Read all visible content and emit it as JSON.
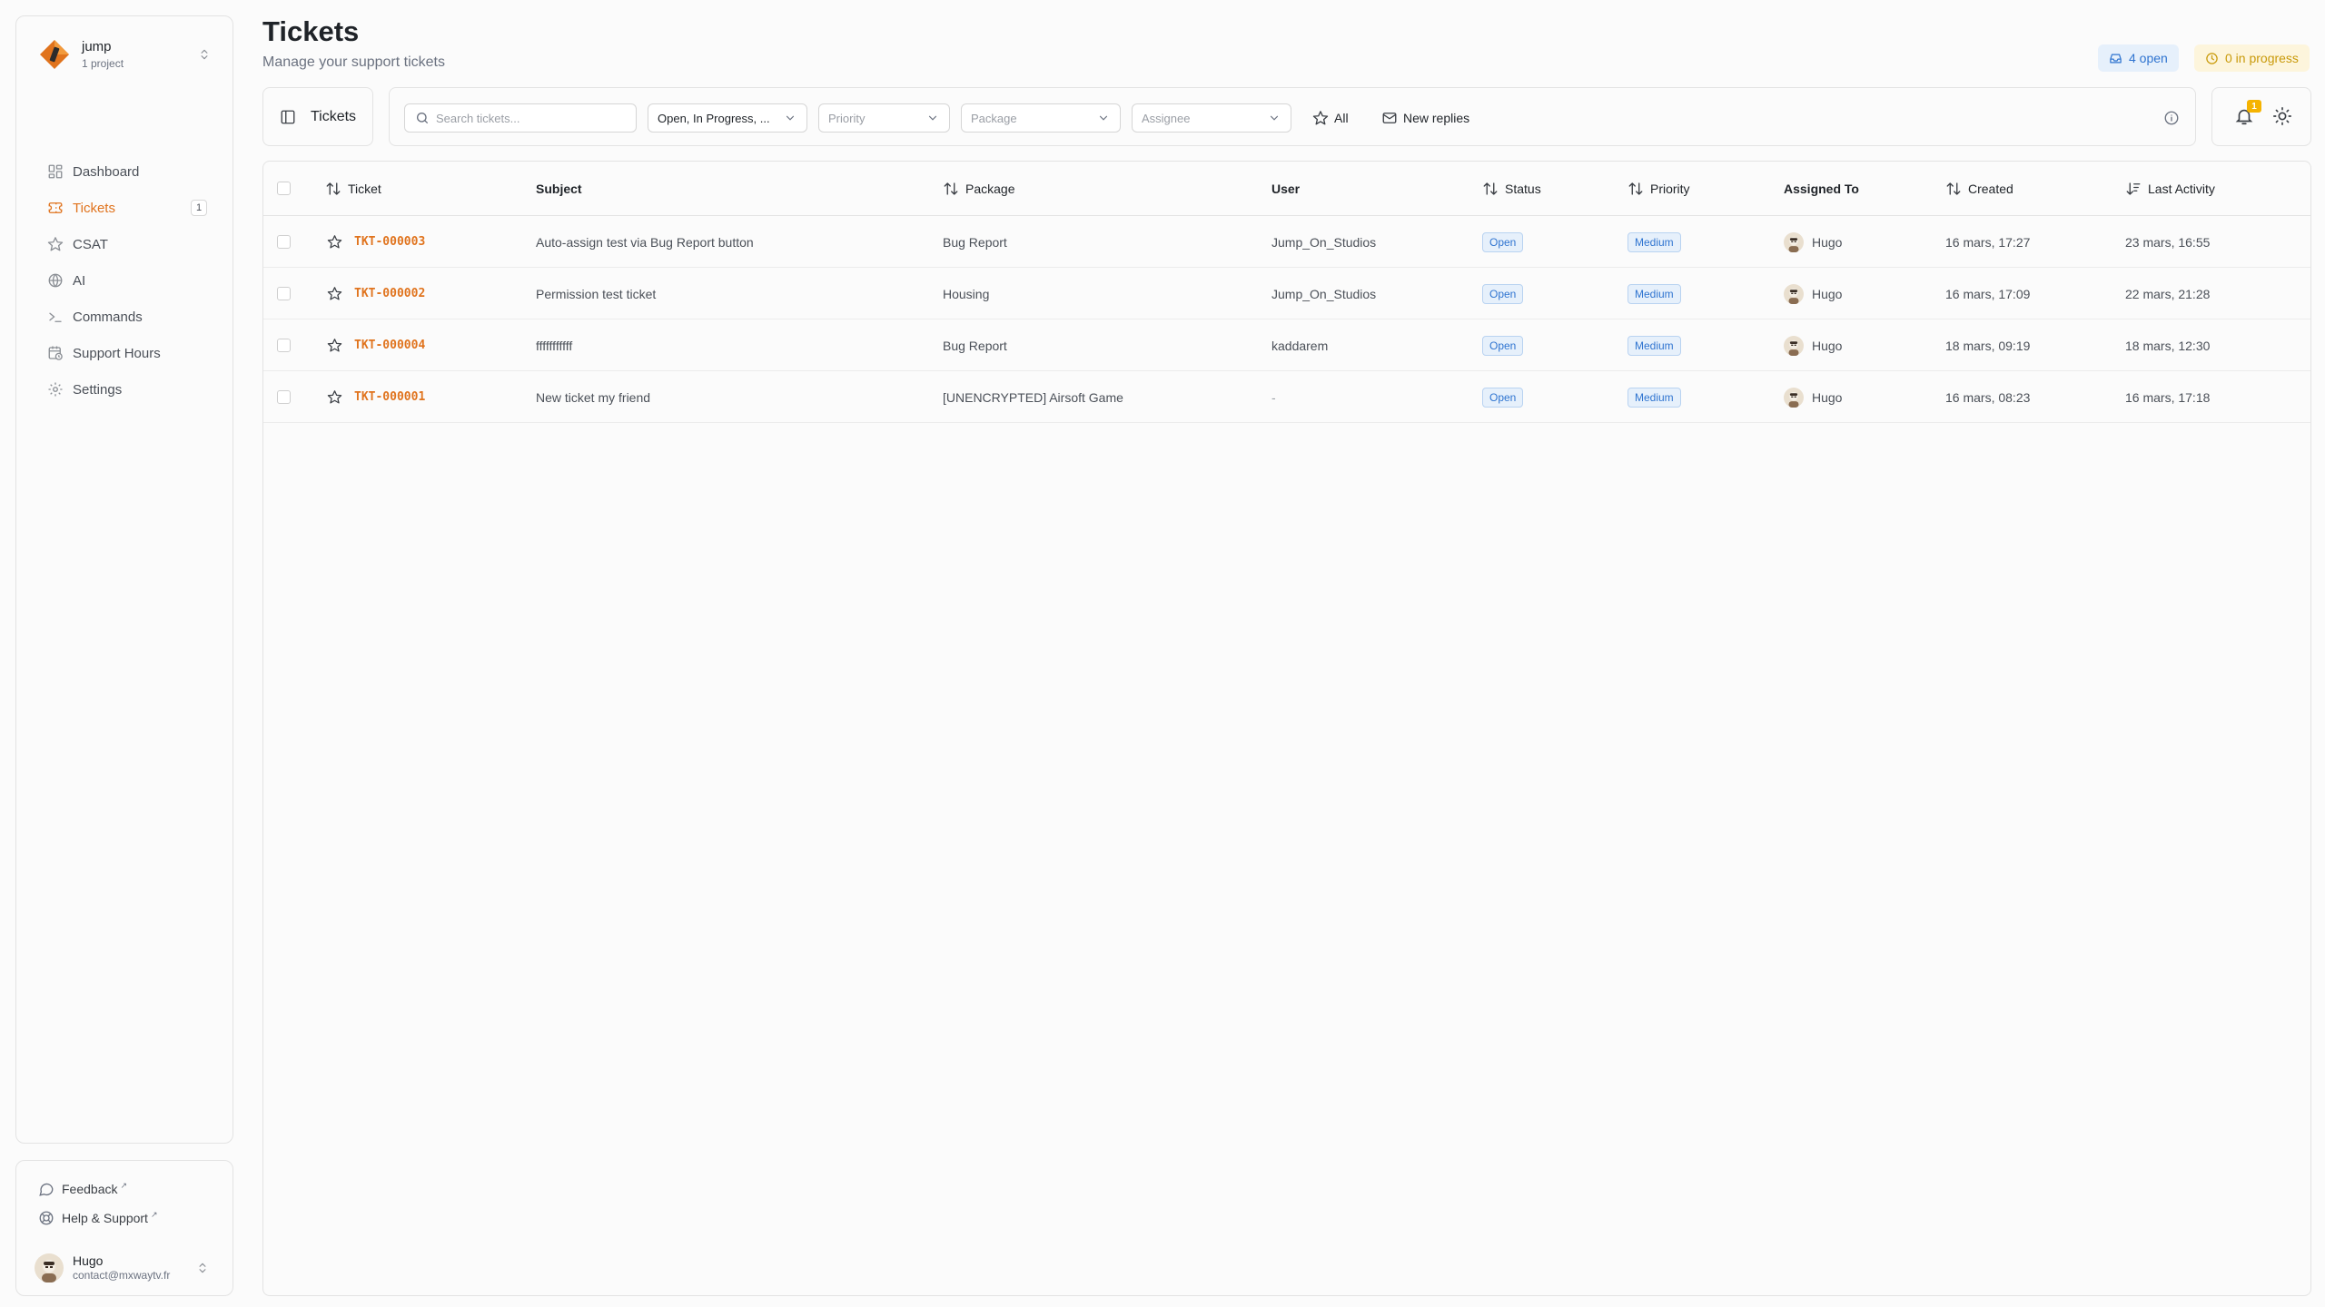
{
  "project": {
    "name": "jump",
    "count": "1 project"
  },
  "nav": [
    {
      "label": "Dashboard",
      "icon": "dashboard-icon"
    },
    {
      "label": "Tickets",
      "icon": "ticket-icon",
      "badge": "1",
      "active": true
    },
    {
      "label": "CSAT",
      "icon": "star-icon"
    },
    {
      "label": "AI",
      "icon": "globe-icon"
    },
    {
      "label": "Commands",
      "icon": "terminal-icon"
    },
    {
      "label": "Support Hours",
      "icon": "calendar-clock-icon"
    },
    {
      "label": "Settings",
      "icon": "gear-icon"
    }
  ],
  "footer": {
    "feedback": "Feedback",
    "help": "Help & Support",
    "user_name": "Hugo",
    "user_email": "contact@mxwaytv.fr"
  },
  "header": {
    "title": "Tickets",
    "subtitle": "Manage your support tickets",
    "open_badge": "4 open",
    "progress_badge": "0 in progress"
  },
  "toolbar": {
    "title": "Tickets",
    "search_placeholder": "Search tickets...",
    "status_value": "Open, In Progress, ...",
    "priority_placeholder": "Priority",
    "package_placeholder": "Package",
    "assignee_placeholder": "Assignee",
    "all_label": "All",
    "new_replies_label": "New replies",
    "notification_count": "1"
  },
  "table": {
    "headers": {
      "ticket": "Ticket",
      "subject": "Subject",
      "package": "Package",
      "user": "User",
      "status": "Status",
      "priority": "Priority",
      "assigned": "Assigned To",
      "created": "Created",
      "last_activity": "Last Activity"
    },
    "rows": [
      {
        "id": "TKT-000003",
        "subject": "Auto-assign test via Bug Report button",
        "package": "Bug Report",
        "user": "Jump_On_Studios",
        "status": "Open",
        "priority": "Medium",
        "assignee": "Hugo",
        "created": "16 mars, 17:27",
        "last_activity": "23 mars, 16:55"
      },
      {
        "id": "TKT-000002",
        "subject": "Permission test ticket",
        "package": "Housing",
        "user": "Jump_On_Studios",
        "status": "Open",
        "priority": "Medium",
        "assignee": "Hugo",
        "created": "16 mars, 17:09",
        "last_activity": "22 mars, 21:28"
      },
      {
        "id": "TKT-000004",
        "subject": "fffffffffff",
        "package": "Bug Report",
        "user": "kaddarem",
        "status": "Open",
        "priority": "Medium",
        "assignee": "Hugo",
        "created": "18 mars, 09:19",
        "last_activity": "18 mars, 12:30"
      },
      {
        "id": "TKT-000001",
        "subject": "New ticket my friend",
        "package": "[UNENCRYPTED] Airsoft Game",
        "user": "-",
        "status": "Open",
        "priority": "Medium",
        "assignee": "Hugo",
        "created": "16 mars, 08:23",
        "last_activity": "16 mars, 17:18"
      }
    ]
  },
  "colors": {
    "accent": "#e0731d",
    "open_blue": "#2f74d0",
    "progress_yellow": "#c99a0a",
    "notification": "#f5b301"
  }
}
